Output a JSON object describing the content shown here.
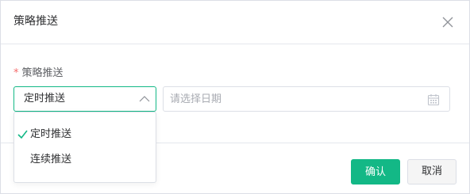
{
  "dialog": {
    "title": "策略推送"
  },
  "form": {
    "required_mark": "*",
    "label": "策略推送",
    "select": {
      "value": "定时推送",
      "options": [
        {
          "label": "定时推送",
          "selected": true
        },
        {
          "label": "连续推送",
          "selected": false
        }
      ]
    },
    "date": {
      "placeholder": "请选择日期",
      "value": ""
    }
  },
  "footer": {
    "confirm_label": "确认",
    "cancel_label": "取消"
  },
  "colors": {
    "accent": "#13b886",
    "required": "#f56c6c",
    "border": "#dcdfe6"
  },
  "icons": {
    "close": "close-icon",
    "arrow": "chevron-up-icon",
    "calendar": "calendar-icon",
    "check": "check-icon"
  }
}
